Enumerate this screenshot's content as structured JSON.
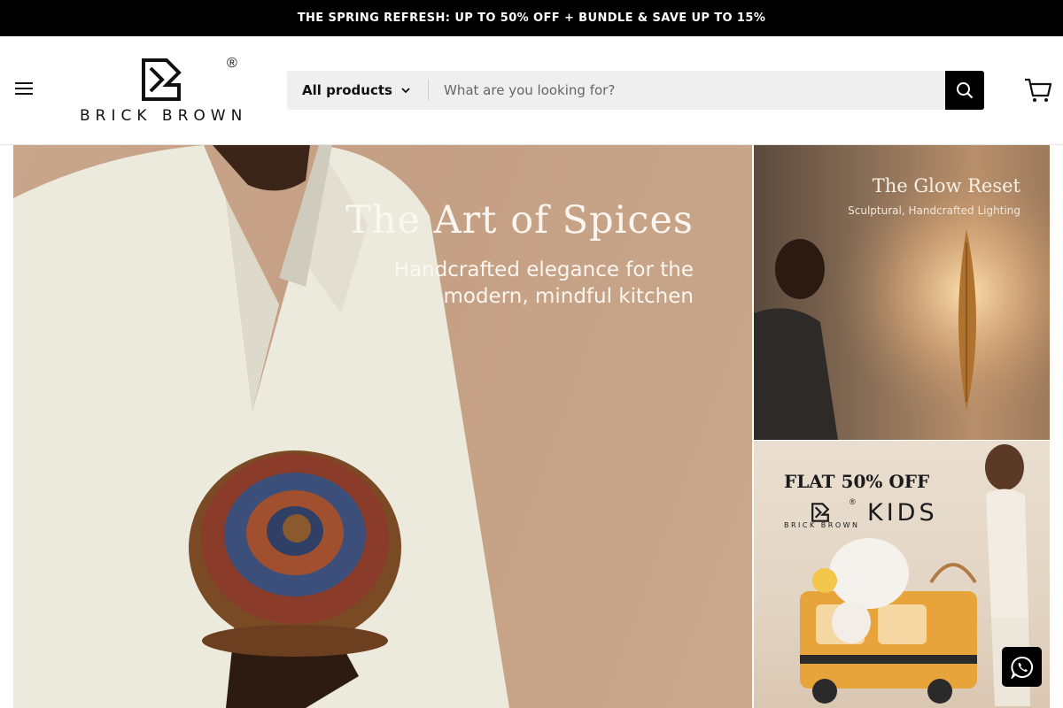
{
  "announcement": {
    "text": "THE SPRING REFRESH: UP TO 50% OFF + BUNDLE & SAVE UP TO 15%"
  },
  "header": {
    "logo": {
      "wordmark": "BRICK BROWN",
      "registered": "®"
    },
    "search": {
      "category_label": "All products",
      "placeholder": "What are you looking for?"
    }
  },
  "hero": {
    "title": "The Art of Spices",
    "subtitle": "Handcrafted elegance for the modern, mindful kitchen"
  },
  "promo_lighting": {
    "title": "The Glow Reset",
    "subtitle": "Sculptural, Handcrafted Lighting"
  },
  "promo_kids": {
    "title": "FLAT 50% OFF",
    "logo_wordmark": "BRICK BROWN",
    "logo_registered": "®",
    "kids_label": "KIDS"
  },
  "icons": {
    "menu": "hamburger-icon",
    "chevron": "chevron-down-icon",
    "search": "search-icon",
    "cart": "cart-icon",
    "whatsapp": "whatsapp-icon"
  },
  "colors": {
    "announcement_bg": "#000000",
    "search_bg": "#efefef",
    "button_bg": "#000000",
    "hero_bg": "#c9a58a"
  }
}
